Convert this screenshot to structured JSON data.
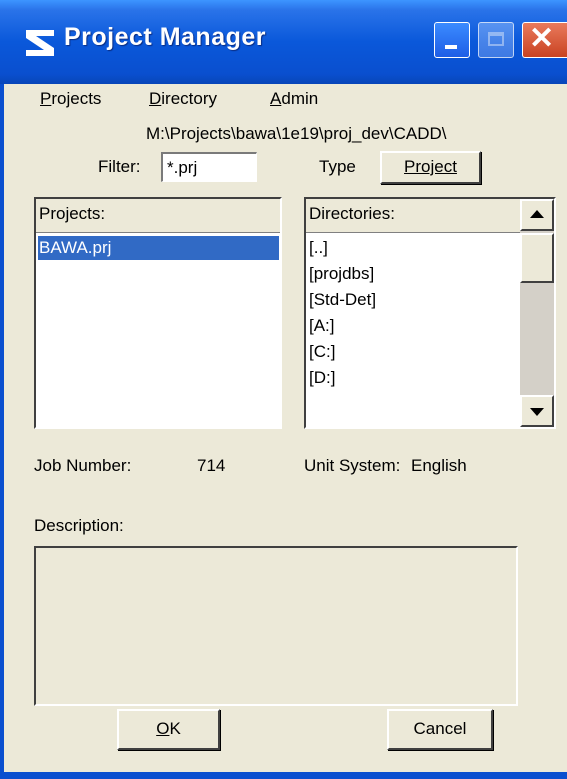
{
  "window": {
    "title": "Project Manager",
    "icon": "bentley-logo-icon"
  },
  "menu": {
    "projects": {
      "accel": "P",
      "rest": "rojects"
    },
    "directory": {
      "accel": "D",
      "rest": "irectory"
    },
    "admin": {
      "pre": "A",
      "accel": "d",
      "rest": "min"
    }
  },
  "path": "M:\\Projects\\bawa\\1e19\\proj_dev\\CADD\\",
  "filter": {
    "label": "Filter:",
    "value": "*.prj"
  },
  "type": {
    "label": "Type",
    "button": "Project"
  },
  "projects_list": {
    "header": "Projects:",
    "items": [
      "BAWA.prj"
    ],
    "selected": 0
  },
  "directories_list": {
    "header": "Directories:",
    "items": [
      "[..]",
      "[projdbs]",
      "[Std-Det]",
      "[A:]",
      "[C:]",
      "[D:]"
    ]
  },
  "job_number": {
    "label": "Job Number:",
    "value": "714"
  },
  "unit_system": {
    "label": "Unit System:",
    "value": "English"
  },
  "description": {
    "label": "Description:",
    "value": ""
  },
  "buttons": {
    "ok": {
      "accel": "O",
      "rest": "K"
    },
    "cancel": "Cancel"
  },
  "colors": {
    "titlebar": "#0a58da",
    "selection": "#316ac5",
    "face": "#ece9d8"
  }
}
